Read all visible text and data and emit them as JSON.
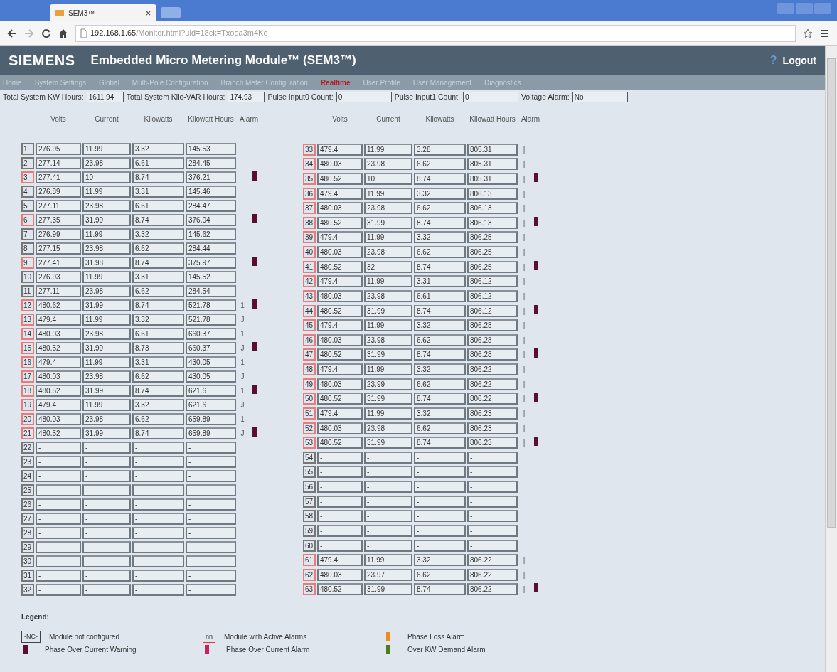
{
  "browser": {
    "tab_title": "SEM3™",
    "address_host": "192.168.1.65",
    "address_path": "/Monitor.html?uid=18ck=Txooa3m4Ko"
  },
  "header": {
    "brand": "SIEMENS",
    "title": "Embedded Micro Metering Module™ (SEM3™)",
    "help": "?",
    "logout": "Logout"
  },
  "nav": [
    {
      "label": "Home",
      "selected": false
    },
    {
      "label": "System Settings",
      "selected": false
    },
    {
      "label": "Global",
      "selected": false
    },
    {
      "label": "Multi-Pole Configuration",
      "selected": false
    },
    {
      "label": "Branch Meter Configuration",
      "selected": false
    },
    {
      "label": "Realtime",
      "selected": true
    },
    {
      "label": "User Profile",
      "selected": false
    },
    {
      "label": "User Management",
      "selected": false
    },
    {
      "label": "Diagnostics",
      "selected": false
    }
  ],
  "summary": [
    {
      "label": "Total System KW Hours:",
      "value": "1611.94"
    },
    {
      "label": "Total System Kilo-VAR Hours:",
      "value": "174.93"
    },
    {
      "label": "Pulse Input0 Count:",
      "value": "0"
    },
    {
      "label": "Pulse Input1 Count:",
      "value": "0"
    },
    {
      "label": "Voltage Alarm:",
      "value": "No"
    }
  ],
  "tables": [
    {
      "columns": [
        "Volts",
        "Current",
        "Kilowatts",
        "Kilowatt Hours",
        "Alarm"
      ],
      "rows": [
        {
          "module": "1",
          "active_alarm": false,
          "values": [
            "276.95",
            "11.99",
            "3.32",
            "145.53"
          ],
          "warning": false
        },
        {
          "module": "2",
          "active_alarm": false,
          "values": [
            "277.14",
            "23.98",
            "6.61",
            "284.45"
          ],
          "warning": false
        },
        {
          "module": "3",
          "active_alarm": true,
          "values": [
            "277.41",
            "10",
            "8.74",
            "376.21"
          ],
          "warning": true
        },
        {
          "module": "4",
          "active_alarm": false,
          "values": [
            "276.89",
            "11.99",
            "3.31",
            "145.46"
          ],
          "warning": false
        },
        {
          "module": "5",
          "active_alarm": false,
          "values": [
            "277.11",
            "23.98",
            "6.61",
            "284.47"
          ],
          "warning": false
        },
        {
          "module": "6",
          "active_alarm": true,
          "values": [
            "277.35",
            "31.99",
            "8.74",
            "376.04"
          ],
          "warning": true
        },
        {
          "module": "7",
          "active_alarm": false,
          "values": [
            "276.99",
            "11.99",
            "3.32",
            "145.62"
          ],
          "warning": false
        },
        {
          "module": "8",
          "active_alarm": false,
          "values": [
            "277.15",
            "23.98",
            "6.62",
            "284.44"
          ],
          "warning": false
        },
        {
          "module": "9",
          "active_alarm": true,
          "values": [
            "277.41",
            "31.98",
            "8.74",
            "375.97"
          ],
          "warning": true
        },
        {
          "module": "10",
          "active_alarm": false,
          "values": [
            "276.93",
            "11.99",
            "3.31",
            "145.52"
          ],
          "warning": false
        },
        {
          "module": "11",
          "active_alarm": false,
          "values": [
            "277.11",
            "23.98",
            "6.62",
            "284.54"
          ],
          "warning": false
        },
        {
          "module": "12",
          "active_alarm": true,
          "values": [
            "480.62",
            "31.99",
            "8.74",
            "521.78"
          ],
          "flag": "1",
          "warning": true
        },
        {
          "module": "13",
          "active_alarm": true,
          "values": [
            "479.4",
            "11.99",
            "3.32",
            "521.78"
          ],
          "flag": "J",
          "warning": false
        },
        {
          "module": "14",
          "active_alarm": true,
          "values": [
            "480.03",
            "23.98",
            "6.61",
            "660.37"
          ],
          "flag": "1",
          "warning": false
        },
        {
          "module": "15",
          "active_alarm": true,
          "values": [
            "480.52",
            "31.99",
            "8.73",
            "660.37"
          ],
          "flag": "J",
          "warning": true
        },
        {
          "module": "16",
          "active_alarm": true,
          "values": [
            "479.4",
            "11.99",
            "3.31",
            "430.05"
          ],
          "flag": "1",
          "warning": false
        },
        {
          "module": "17",
          "active_alarm": true,
          "values": [
            "480.03",
            "23.98",
            "6.62",
            "430.05"
          ],
          "flag": "J",
          "warning": false
        },
        {
          "module": "18",
          "active_alarm": true,
          "values": [
            "480.52",
            "31.99",
            "8.74",
            "621.6"
          ],
          "flag": "1",
          "warning": true
        },
        {
          "module": "19",
          "active_alarm": true,
          "values": [
            "479.4",
            "11.99",
            "3.32",
            "621.6"
          ],
          "flag": "J",
          "warning": false
        },
        {
          "module": "20",
          "active_alarm": true,
          "values": [
            "480.03",
            "23.98",
            "6.62",
            "659.89"
          ],
          "flag": "1",
          "warning": false
        },
        {
          "module": "21",
          "active_alarm": true,
          "values": [
            "480.52",
            "31.99",
            "8.74",
            "659.89"
          ],
          "flag": "J",
          "warning": true
        },
        {
          "module": "22",
          "active_alarm": false,
          "values": [
            "-",
            "-",
            "-",
            "-"
          ],
          "warning": false
        },
        {
          "module": "23",
          "active_alarm": false,
          "values": [
            "-",
            "-",
            "-",
            "-"
          ],
          "warning": false
        },
        {
          "module": "24",
          "active_alarm": false,
          "values": [
            "-",
            "-",
            "-",
            "-"
          ],
          "warning": false
        },
        {
          "module": "25",
          "active_alarm": false,
          "values": [
            "-",
            "-",
            "-",
            "-"
          ],
          "warning": false
        },
        {
          "module": "26",
          "active_alarm": false,
          "values": [
            "-",
            "-",
            "-",
            "-"
          ],
          "warning": false
        },
        {
          "module": "27",
          "active_alarm": false,
          "values": [
            "-",
            "-",
            "-",
            "-"
          ],
          "warning": false
        },
        {
          "module": "28",
          "active_alarm": false,
          "values": [
            "-",
            "-",
            "-",
            "-"
          ],
          "warning": false
        },
        {
          "module": "29",
          "active_alarm": false,
          "values": [
            "-",
            "-",
            "-",
            "-"
          ],
          "warning": false
        },
        {
          "module": "30",
          "active_alarm": false,
          "values": [
            "-",
            "-",
            "-",
            "-"
          ],
          "warning": false
        },
        {
          "module": "31",
          "active_alarm": false,
          "values": [
            "-",
            "-",
            "-",
            "-"
          ],
          "warning": false
        },
        {
          "module": "32",
          "active_alarm": false,
          "values": [
            "-",
            "-",
            "-",
            "-"
          ],
          "warning": false
        }
      ]
    },
    {
      "columns": [
        "Volts",
        "Current",
        "Kilowatts",
        "Kilowatt Hours",
        "Alarm"
      ],
      "rows": [
        {
          "module": "33",
          "active_alarm": true,
          "values": [
            "479.4",
            "11.99",
            "3.28",
            "805.31"
          ],
          "flag": "|",
          "warning": false
        },
        {
          "module": "34",
          "active_alarm": true,
          "values": [
            "480.03",
            "23.98",
            "6.62",
            "805.31"
          ],
          "flag": "|",
          "warning": false
        },
        {
          "module": "35",
          "active_alarm": true,
          "values": [
            "480.52",
            "10",
            "8.74",
            "805.31"
          ],
          "flag": "|",
          "warning": true
        },
        {
          "module": "36",
          "active_alarm": true,
          "values": [
            "479.4",
            "11.99",
            "3.32",
            "806.13"
          ],
          "flag": "|",
          "warning": false
        },
        {
          "module": "37",
          "active_alarm": true,
          "values": [
            "480.03",
            "23.98",
            "6.62",
            "806.13"
          ],
          "flag": "|",
          "warning": false
        },
        {
          "module": "38",
          "active_alarm": true,
          "values": [
            "480.52",
            "31.99",
            "8.74",
            "806.13"
          ],
          "flag": "|",
          "warning": true
        },
        {
          "module": "39",
          "active_alarm": true,
          "values": [
            "479.4",
            "11.99",
            "3.32",
            "806.25"
          ],
          "flag": "|",
          "warning": false
        },
        {
          "module": "40",
          "active_alarm": true,
          "values": [
            "480.03",
            "23.98",
            "6.62",
            "806.25"
          ],
          "flag": "|",
          "warning": false
        },
        {
          "module": "41",
          "active_alarm": true,
          "values": [
            "480.52",
            "32",
            "8.74",
            "806.25"
          ],
          "flag": "|",
          "warning": true
        },
        {
          "module": "42",
          "active_alarm": true,
          "values": [
            "479.4",
            "11.99",
            "3.31",
            "806.12"
          ],
          "flag": "|",
          "warning": false
        },
        {
          "module": "43",
          "active_alarm": true,
          "values": [
            "480.03",
            "23.98",
            "6.61",
            "806.12"
          ],
          "flag": "|",
          "warning": false
        },
        {
          "module": "44",
          "active_alarm": true,
          "values": [
            "480.52",
            "31.99",
            "8.74",
            "806.12"
          ],
          "flag": "|",
          "warning": true
        },
        {
          "module": "45",
          "active_alarm": true,
          "values": [
            "479.4",
            "11.99",
            "3.32",
            "806.28"
          ],
          "flag": "|",
          "warning": false
        },
        {
          "module": "46",
          "active_alarm": true,
          "values": [
            "480.03",
            "23.98",
            "6.62",
            "806.28"
          ],
          "flag": "|",
          "warning": false
        },
        {
          "module": "47",
          "active_alarm": true,
          "values": [
            "480.52",
            "31.99",
            "8.74",
            "806.28"
          ],
          "flag": "|",
          "warning": true
        },
        {
          "module": "48",
          "active_alarm": true,
          "values": [
            "479.4",
            "11.99",
            "3.32",
            "806.22"
          ],
          "flag": "|",
          "warning": false
        },
        {
          "module": "49",
          "active_alarm": true,
          "values": [
            "480.03",
            "23.99",
            "6.62",
            "806.22"
          ],
          "flag": "|",
          "warning": false
        },
        {
          "module": "50",
          "active_alarm": true,
          "values": [
            "480.52",
            "31.99",
            "8.74",
            "806.22"
          ],
          "flag": "|",
          "warning": true
        },
        {
          "module": "51",
          "active_alarm": true,
          "values": [
            "479.4",
            "11.99",
            "3.32",
            "806.23"
          ],
          "flag": "|",
          "warning": false
        },
        {
          "module": "52",
          "active_alarm": true,
          "values": [
            "480.03",
            "23.98",
            "6.62",
            "806.23"
          ],
          "flag": "|",
          "warning": false
        },
        {
          "module": "53",
          "active_alarm": true,
          "values": [
            "480.52",
            "31.99",
            "8.74",
            "806.23"
          ],
          "flag": "|",
          "warning": true
        },
        {
          "module": "54",
          "active_alarm": false,
          "values": [
            "-",
            "-",
            "-",
            "-"
          ],
          "warning": false
        },
        {
          "module": "55",
          "active_alarm": false,
          "values": [
            "-",
            "-",
            "-",
            "-"
          ],
          "warning": false
        },
        {
          "module": "56",
          "active_alarm": false,
          "values": [
            "-",
            "-",
            "-",
            "-"
          ],
          "warning": false
        },
        {
          "module": "57",
          "active_alarm": false,
          "values": [
            "-",
            "-",
            "-",
            "-"
          ],
          "warning": false
        },
        {
          "module": "58",
          "active_alarm": false,
          "values": [
            "-",
            "-",
            "-",
            "-"
          ],
          "warning": false
        },
        {
          "module": "59",
          "active_alarm": false,
          "values": [
            "-",
            "-",
            "-",
            "-"
          ],
          "warning": false
        },
        {
          "module": "60",
          "active_alarm": false,
          "values": [
            "-",
            "-",
            "-",
            "-"
          ],
          "warning": false
        },
        {
          "module": "61",
          "active_alarm": true,
          "values": [
            "479.4",
            "11.99",
            "3.32",
            "806.22"
          ],
          "flag": "|",
          "warning": false
        },
        {
          "module": "62",
          "active_alarm": true,
          "values": [
            "480.03",
            "23.97",
            "6.62",
            "806.22"
          ],
          "flag": "|",
          "warning": false
        },
        {
          "module": "63",
          "active_alarm": true,
          "values": [
            "480.52",
            "31.99",
            "8.74",
            "806.22"
          ],
          "flag": "|",
          "warning": true
        }
      ]
    }
  ],
  "legend": {
    "title": "Legend:",
    "items": [
      {
        "kind": "box",
        "swatch": "-NC-",
        "active_alarm": false,
        "label": "Module not configured"
      },
      {
        "kind": "box",
        "swatch": "nn",
        "active_alarm": true,
        "label": "Module with Active Alarms"
      },
      {
        "kind": "bar",
        "color": "#f08a1c",
        "label": "Phase Loss Alarm"
      },
      {
        "kind": "bar",
        "color": "#5a0f2e",
        "label": "Phase Over Current Warning"
      },
      {
        "kind": "bar",
        "color": "#c8245a",
        "label": "Phase Over Current Alarm"
      },
      {
        "kind": "bar",
        "color": "#4f7a1e",
        "label": "Over KW Demand Alarm"
      }
    ]
  }
}
